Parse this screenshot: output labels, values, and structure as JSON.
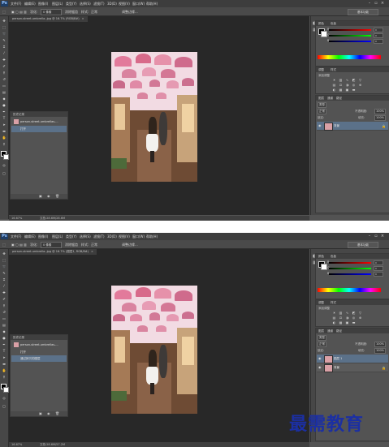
{
  "app": {
    "logo": "Ps",
    "menu": [
      "文件(F)",
      "编辑(E)",
      "图像(I)",
      "图层(L)",
      "类型(Y)",
      "选择(S)",
      "滤镜(T)",
      "3D(D)",
      "视图(V)",
      "窗口(W)",
      "帮助(H)"
    ],
    "workspace": "基本功能",
    "window_controls": [
      "–",
      "▫",
      "×"
    ]
  },
  "options_bar": {
    "feather_label": "羽化:",
    "feather_value": "0 像素",
    "antialias": "消除锯齿",
    "style_label": "样式:",
    "style_value": "正常",
    "refine_edge": "调整边缘..."
  },
  "screens": [
    {
      "document": {
        "tab_title": "person-street-umbrella-.jpg @ 16.7% (RGB/8#)",
        "close": "×",
        "zoom": "16.67%",
        "doc_info": "文档:28.6M/28.6M"
      },
      "history": {
        "title": "历史记录",
        "snapshot": "person-street-umbrellas-...",
        "rows": [
          "打开"
        ]
      },
      "layers": {
        "tabs": [
          "图层",
          "通道",
          "路径"
        ],
        "kind": "类型",
        "blend": "正常",
        "opacity_label": "不透明度:",
        "opacity": "100%",
        "lock_label": "锁定:",
        "fill_label": "填充:",
        "fill": "100%",
        "rows": [
          {
            "name": "背景",
            "selected": true,
            "locked": true
          }
        ]
      }
    },
    {
      "document": {
        "tab_title": "person-street-umbrella-.jpg @ 16.7% (图层1, RGB/8#)",
        "close": "×",
        "zoom": "16.67%",
        "doc_info": "文档:28.6M/57.2M"
      },
      "history": {
        "title": "历史记录",
        "snapshot": "person-street-umbrellas-...",
        "rows": [
          "打开",
          "通过拷贝的图层"
        ]
      },
      "layers": {
        "tabs": [
          "图层",
          "通道",
          "路径"
        ],
        "kind": "类型",
        "blend": "正常",
        "opacity_label": "不透明度:",
        "opacity": "100%",
        "lock_label": "锁定:",
        "fill_label": "填充:",
        "fill": "100%",
        "rows": [
          {
            "name": "图层 1",
            "selected": true,
            "locked": false
          },
          {
            "name": "背景",
            "selected": false,
            "locked": true
          }
        ]
      }
    }
  ],
  "color_panel": {
    "tabs": [
      "颜色",
      "色板"
    ],
    "channels": [
      "R",
      "G",
      "B"
    ],
    "values": [
      "0",
      "0",
      "0"
    ]
  },
  "adjustments": {
    "tabs": [
      "调整",
      "样式"
    ],
    "title": "添加调整"
  },
  "watermark": "最需教育",
  "colors": {
    "ui_bg": "#535353",
    "canvas_bg": "#282828",
    "selection": "#5b7189",
    "watermark": "#1b2fa3"
  }
}
